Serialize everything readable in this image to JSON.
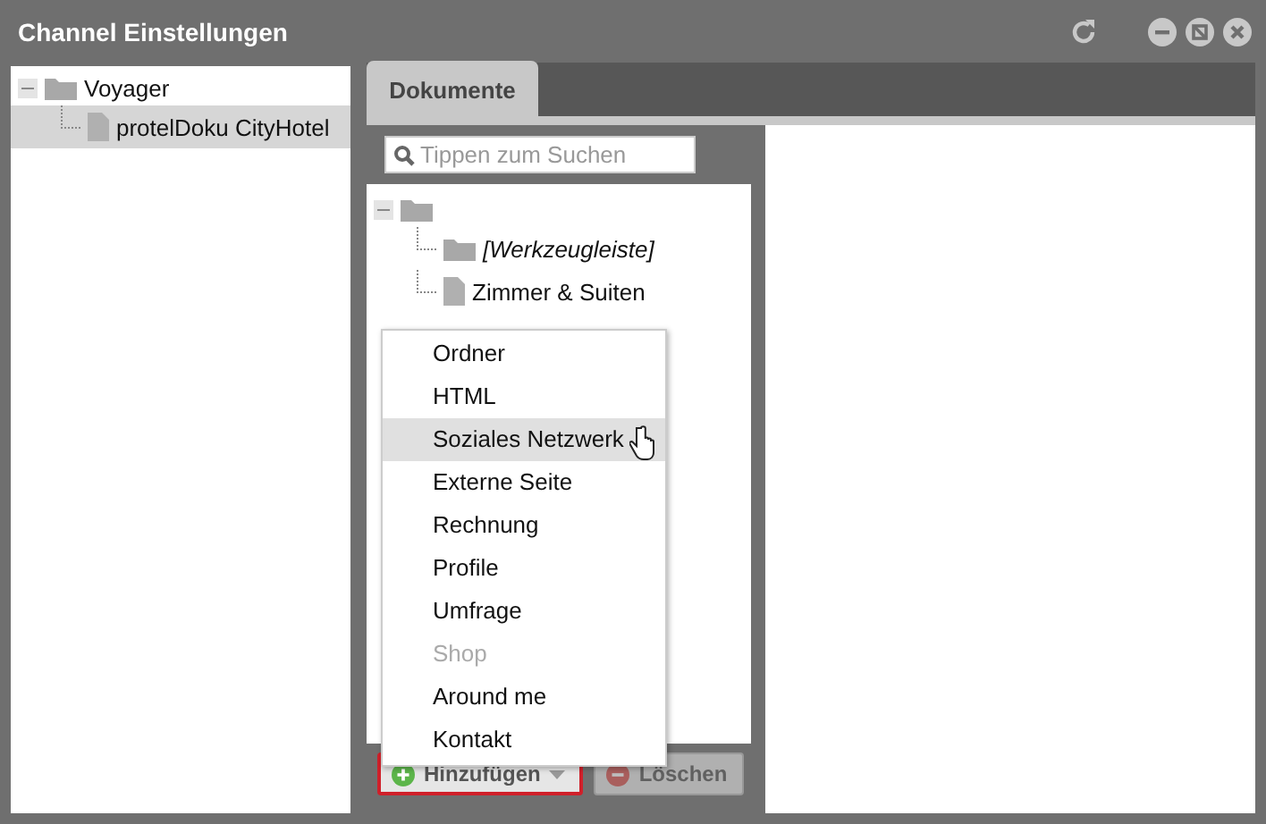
{
  "window": {
    "title": "Channel Einstellungen"
  },
  "channel_tree": [
    {
      "label": "Voyager",
      "kind": "folder",
      "selected": false,
      "children": [
        {
          "label": "protelDoku CityHotel",
          "kind": "file",
          "selected": true
        }
      ]
    }
  ],
  "tabs": [
    {
      "label": "Dokumente",
      "selected": true
    }
  ],
  "search": {
    "placeholder": "Tippen zum Suchen"
  },
  "document_tree": {
    "children": [
      {
        "label": "[Werkzeugleiste]",
        "kind": "folder",
        "italic": true
      },
      {
        "label": "Zimmer & Suiten",
        "kind": "file",
        "italic": false
      }
    ]
  },
  "add_menu": [
    {
      "label": "Ordner",
      "selected": false,
      "disabled": false
    },
    {
      "label": "HTML",
      "selected": false,
      "disabled": false
    },
    {
      "label": "Soziales Netzwerk",
      "selected": true,
      "disabled": false
    },
    {
      "label": "Externe Seite",
      "selected": false,
      "disabled": false
    },
    {
      "label": "Rechnung",
      "selected": false,
      "disabled": false
    },
    {
      "label": "Profile",
      "selected": false,
      "disabled": false
    },
    {
      "label": "Umfrage",
      "selected": false,
      "disabled": false
    },
    {
      "label": "Shop",
      "selected": false,
      "disabled": true
    },
    {
      "label": "Around me",
      "selected": false,
      "disabled": false
    },
    {
      "label": "Kontakt",
      "selected": false,
      "disabled": false
    }
  ],
  "buttons": [
    {
      "label": "Hinzufügen",
      "kind": "add",
      "disabled": false,
      "focused": true
    },
    {
      "label": "Löschen",
      "kind": "delete",
      "disabled": true,
      "focused": false
    }
  ]
}
